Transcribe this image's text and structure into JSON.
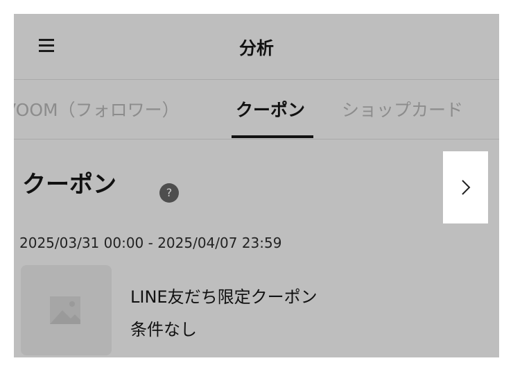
{
  "header": {
    "title": "分析",
    "menu_icon": "hamburger-menu-icon"
  },
  "tabs": [
    {
      "label": "VOOM（フォロワー）",
      "active": false
    },
    {
      "label": "クーポン",
      "active": true
    },
    {
      "label": "ショップカード",
      "active": false
    }
  ],
  "section": {
    "title": "クーポン",
    "help_label": "?",
    "next_icon": "chevron-right-icon",
    "date_range": "2025/03/31 00:00 - 2025/04/07 23:59"
  },
  "coupon": {
    "name": "LINE友だち限定クーポン",
    "condition": "条件なし",
    "thumbnail_icon": "image-placeholder-icon"
  },
  "colors": {
    "overlay_bg": "#bebebe",
    "active_tab": "#111111",
    "inactive_tab": "#8c8c8c",
    "next_button_bg": "#ffffff"
  }
}
